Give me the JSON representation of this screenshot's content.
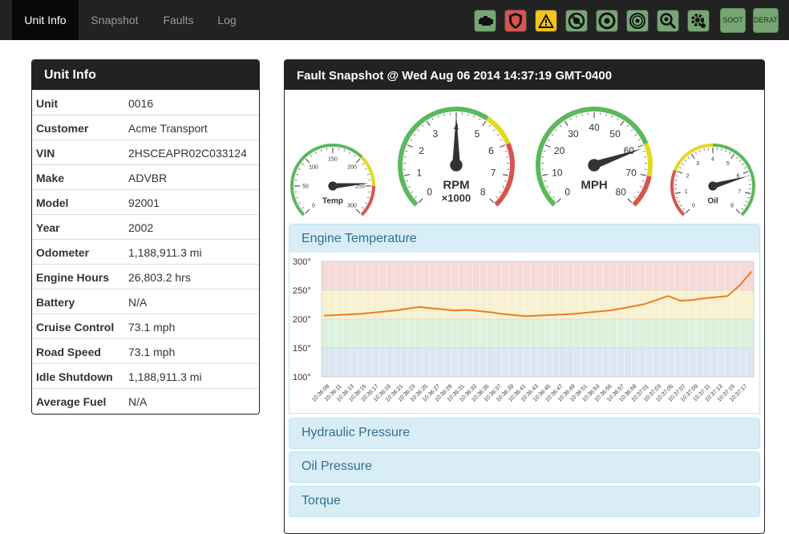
{
  "nav": {
    "tabs": [
      {
        "label": "Unit Info",
        "active": true
      },
      {
        "label": "Snapshot",
        "active": false
      },
      {
        "label": "Faults",
        "active": false
      },
      {
        "label": "Log",
        "active": false
      }
    ],
    "status_icons": [
      {
        "icon": "engine-icon",
        "color": "#76a773"
      },
      {
        "icon": "shield-icon",
        "color": "#d9534f"
      },
      {
        "icon": "warning-icon",
        "color": "#f0c419"
      },
      {
        "icon": "brake-icon",
        "color": "#76a773"
      },
      {
        "icon": "wheel-icon",
        "color": "#76a773"
      },
      {
        "icon": "disc-brake-icon",
        "color": "#76a773"
      },
      {
        "icon": "search-gear-icon",
        "color": "#76a773"
      },
      {
        "icon": "settings-icon",
        "color": "#76a773"
      }
    ],
    "buttons": [
      {
        "label": "SOOT"
      },
      {
        "label": "DERATE"
      }
    ]
  },
  "unit_info": {
    "title": "Unit Info",
    "rows": [
      {
        "key": "Unit",
        "value": "0016"
      },
      {
        "key": "Customer",
        "value": "Acme Transport"
      },
      {
        "key": "VIN",
        "value": "2HSCEAPR02C033124"
      },
      {
        "key": "Make",
        "value": "ADVBR"
      },
      {
        "key": "Model",
        "value": "92001"
      },
      {
        "key": "Year",
        "value": "2002"
      },
      {
        "key": "Odometer",
        "value": "1,188,911.3 mi"
      },
      {
        "key": "Engine Hours",
        "value": "26,803.2 hrs"
      },
      {
        "key": "Battery",
        "value": "N/A"
      },
      {
        "key": "Cruise Control",
        "value": "73.1 mph"
      },
      {
        "key": "Road Speed",
        "value": "73.1 mph"
      },
      {
        "key": "Idle Shutdown",
        "value": "1,188,911.3 mi"
      },
      {
        "key": "Average Fuel",
        "value": "N/A"
      }
    ]
  },
  "snapshot": {
    "title": "Fault Snapshot @ Wed Aug 06 2014 14:37:19 GMT-0400",
    "gauges": {
      "temp": {
        "label": "Temp",
        "ticks": [
          "0",
          "50",
          "100",
          "150",
          "200",
          "250",
          "300"
        ],
        "min": 0,
        "max": 300,
        "value": 245
      },
      "rpm": {
        "label": "RPM",
        "sublabel": "×1000",
        "ticks": [
          "0",
          "1",
          "2",
          "3",
          "4",
          "5",
          "6",
          "7",
          "8"
        ],
        "min": 0,
        "max": 8,
        "value": 4
      },
      "mph": {
        "label": "MPH",
        "ticks": [
          "0",
          "10",
          "20",
          "30",
          "40",
          "50",
          "60",
          "70",
          "80"
        ],
        "min": 0,
        "max": 80,
        "value": 61
      },
      "oil": {
        "label": "Oil",
        "ticks": [
          "0",
          "1",
          "2",
          "3",
          "4",
          "5",
          "6",
          "7",
          "8"
        ],
        "min": 0,
        "max": 8,
        "value": 6.2
      }
    },
    "sections": [
      {
        "label": "Engine Temperature",
        "expanded": true
      },
      {
        "label": "Hydraulic Pressure",
        "expanded": false
      },
      {
        "label": "Oil Pressure",
        "expanded": false
      },
      {
        "label": "Torque",
        "expanded": false
      }
    ]
  },
  "chart_data": {
    "type": "line",
    "title": "",
    "xlabel": "",
    "ylabel": "",
    "ylim": [
      100,
      300
    ],
    "y_ticks": [
      "100°",
      "150°",
      "200°",
      "250°",
      "300°"
    ],
    "bands": [
      {
        "from": 100,
        "to": 150,
        "color": "#dce6f2"
      },
      {
        "from": 150,
        "to": 200,
        "color": "#dcf2dc"
      },
      {
        "from": 200,
        "to": 250,
        "color": "#f7f1d2"
      },
      {
        "from": 250,
        "to": 300,
        "color": "#f5dada"
      }
    ],
    "x": [
      "10:36:09",
      "10:36:11",
      "10:36:13",
      "10:36:15",
      "10:36:17",
      "10:36:19",
      "10:36:21",
      "10:36:23",
      "10:36:25",
      "10:36:27",
      "10:36:29",
      "10:36:31",
      "10:36:33",
      "10:36:35",
      "10:36:37",
      "10:36:39",
      "10:36:41",
      "10:36:43",
      "10:36:45",
      "10:36:47",
      "10:36:49",
      "10:36:51",
      "10:36:53",
      "10:36:55",
      "10:36:57",
      "10:36:59",
      "10:37:01",
      "10:37:03",
      "10:37:05",
      "10:37:07",
      "10:37:09",
      "10:37:11",
      "10:37:13",
      "10:37:15",
      "10:37:17"
    ],
    "series": [
      {
        "name": "",
        "color": "#f07d1a",
        "values": [
          206,
          207,
          208,
          209,
          211,
          213,
          215,
          218,
          221,
          219,
          217,
          215,
          216,
          214,
          212,
          209,
          207,
          205,
          206,
          207,
          208,
          209,
          211,
          213,
          215,
          218,
          222,
          226,
          233,
          240,
          232,
          233,
          236,
          238,
          240,
          258,
          282
        ]
      }
    ]
  }
}
